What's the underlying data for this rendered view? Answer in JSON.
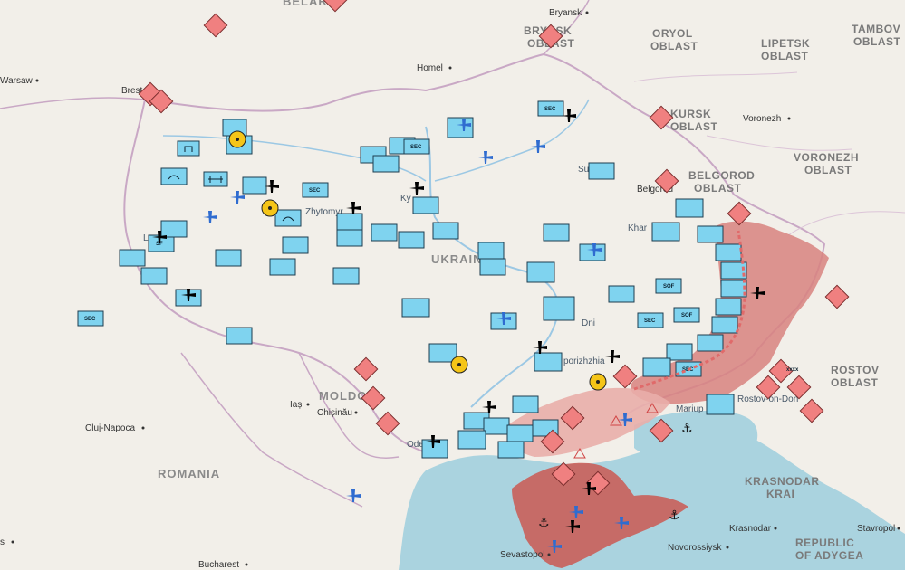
{
  "map": {
    "title": "",
    "country_labels": [
      {
        "id": "ukraine",
        "text": "UKRAINE"
      },
      {
        "id": "romania",
        "text": "ROMANIA"
      },
      {
        "id": "moldova",
        "text": "MOLDO"
      },
      {
        "id": "belarus",
        "text": "BELAR"
      }
    ],
    "region_labels": [
      {
        "id": "oryol",
        "line1": "ORYOL",
        "line2": "OBLAST"
      },
      {
        "id": "lipetsk",
        "line1": "LIPETSK",
        "line2": "OBLAST"
      },
      {
        "id": "tambov",
        "line1": "TAMBOV",
        "line2": "OBLAST"
      },
      {
        "id": "kursk",
        "line1": "KURSK",
        "line2": "OBLAST"
      },
      {
        "id": "belgorod",
        "line1": "BELGOROD",
        "line2": "OBLAST"
      },
      {
        "id": "voronezh",
        "line1": "VORONEZH",
        "line2": "OBLAST"
      },
      {
        "id": "rostov",
        "line1": "ROSTOV",
        "line2": "OBLAST"
      },
      {
        "id": "krasnodar",
        "line1": "KRASNODAR",
        "line2": "KRAI"
      },
      {
        "id": "adygea",
        "line1": "REPUBLIC",
        "line2": "OF ADYGEA"
      },
      {
        "id": "bryansk",
        "line1": "BRYNSK",
        "line2": "OBLAST"
      }
    ],
    "city_labels": [
      {
        "id": "warsaw",
        "text": "Warsaw"
      },
      {
        "id": "brest",
        "text": "Brest"
      },
      {
        "id": "homel",
        "text": "Homel"
      },
      {
        "id": "bryansk",
        "text": "Bryansk"
      },
      {
        "id": "voronezh",
        "text": "Voronezh"
      },
      {
        "id": "belgorod",
        "text": "Belgorod"
      },
      {
        "id": "kharkiv",
        "text": "Khar"
      },
      {
        "id": "sumy",
        "text": "Su"
      },
      {
        "id": "kyiv",
        "text": "Ky"
      },
      {
        "id": "zhytomyr",
        "text": "Zhytomyr"
      },
      {
        "id": "lviv",
        "text": "L"
      },
      {
        "id": "dnipro",
        "text": "Dni"
      },
      {
        "id": "zaporizhzhia",
        "text": "porizhzhia"
      },
      {
        "id": "iasi",
        "text": "Iași"
      },
      {
        "id": "chisinau",
        "text": "Chișinău"
      },
      {
        "id": "odesa",
        "text": "Ode"
      },
      {
        "id": "cluj",
        "text": "Cluj-Napoca"
      },
      {
        "id": "bucharest",
        "text": "Bucharest"
      },
      {
        "id": "mariupol",
        "text": "Mariup"
      },
      {
        "id": "rostov_don",
        "text": "Rostov-on-Don"
      },
      {
        "id": "krasnodar",
        "text": "Krasnodar"
      },
      {
        "id": "novorossiysk",
        "text": "Novorossiysk"
      },
      {
        "id": "stavropol",
        "text": "Stavropol"
      },
      {
        "id": "sevastopol",
        "text": "Sevastopol"
      },
      {
        "id": "s_edge",
        "text": "s"
      }
    ],
    "unit_labels": {
      "sec": "SEC",
      "sof": "SOF",
      "sf": "SF",
      "xxxx": "xxxx"
    },
    "colors": {
      "land": "#f2efe9",
      "sea": "#aad3df",
      "occupied": "#d8837f",
      "occupied_light": "#e9aeaa",
      "friendly_unit": "#7fd3ef",
      "enemy_unit": "#f08080",
      "border": "#c9a8c5",
      "river": "#9cc8e4"
    }
  }
}
